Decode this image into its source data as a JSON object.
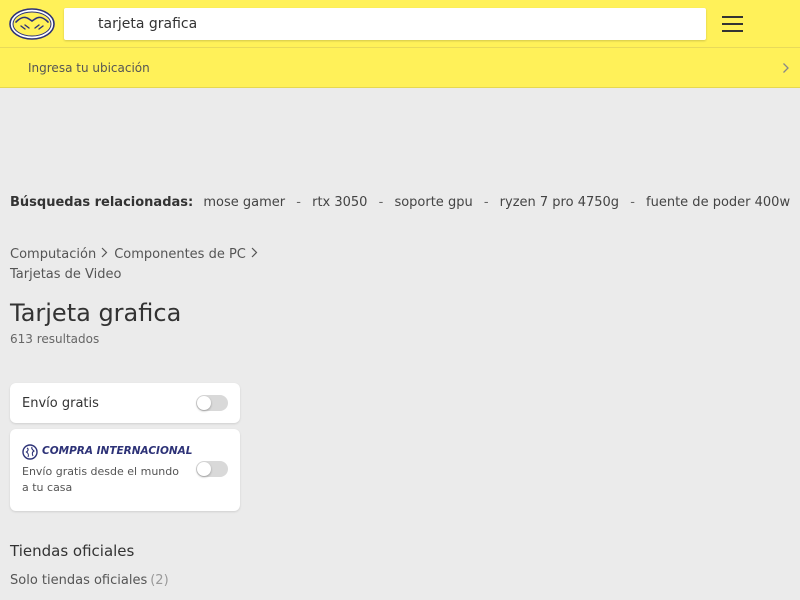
{
  "header": {
    "search_value": "tarjeta grafica",
    "location_text": "Ingresa tu ubicación"
  },
  "related": {
    "label": "Búsquedas relacionadas:",
    "items": [
      "mose gamer",
      "rtx 3050",
      "soporte gpu",
      "ryzen 7 pro 4750g",
      "fuente de poder 400w"
    ]
  },
  "breadcrumb": {
    "items": [
      "Computación",
      "Componentes de PC",
      "Tarjetas de Video"
    ]
  },
  "page": {
    "title": "Tarjeta grafica",
    "results": "613 resultados"
  },
  "filters": {
    "free_shipping_label": "Envío gratis",
    "free_shipping_on": false,
    "international_brand": "COMPRA INTERNACIONAL",
    "international_desc": "Envío gratis desde el mundo a tu casa",
    "international_on": false,
    "official_stores_title": "Tiendas oficiales",
    "official_stores_link": "Solo tiendas oficiales",
    "official_stores_count": "(2)"
  },
  "colors": {
    "header_bg": "#fff159",
    "page_bg": "#ebebeb",
    "brand_blue": "#2d3277"
  },
  "icons": [
    "mercadolibre-logo",
    "hamburger-menu-icon",
    "chevron-right-icon",
    "globe-icon"
  ]
}
